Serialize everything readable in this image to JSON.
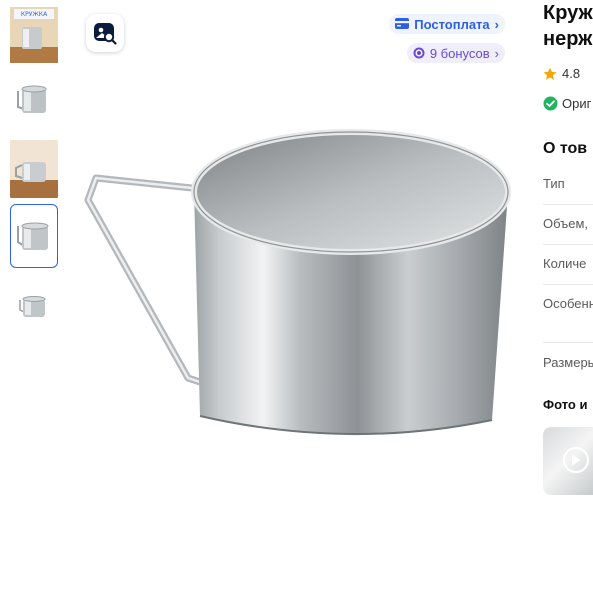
{
  "badges": {
    "postpay": "Постоплата",
    "bonus": "9 бонусов"
  },
  "product": {
    "title_line1": "Круж",
    "title_line2": "нерж",
    "rating": "4.8",
    "original_label": "Ориг"
  },
  "about": {
    "heading": "О тов",
    "specs": [
      "Тип",
      "Объем,",
      "Количе",
      "Особенн",
      "Размеры"
    ]
  },
  "media": {
    "heading": "Фото и"
  },
  "thumb_caption": "КРУЖКА",
  "colors": {
    "accent": "#2e62e8",
    "star": "#f7a600",
    "verified": "#22b35e",
    "bonus": "#6a4ad0"
  }
}
